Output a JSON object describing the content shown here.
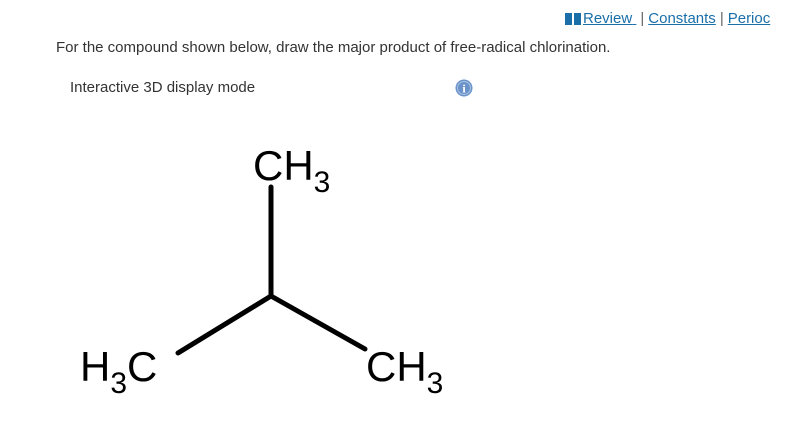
{
  "links": {
    "review": "Review",
    "constants": "Constants",
    "periodic": "Perioc",
    "separator": "|"
  },
  "question": {
    "text": "For the compound shown below, draw the major product of free-radical chlorination."
  },
  "display_mode": {
    "label": "Interactive 3D display mode",
    "info_glyph": "i"
  },
  "molecule": {
    "top_group": {
      "main": "CH",
      "sub": "3"
    },
    "left_group": {
      "pre": "H",
      "sub": "3",
      "post": "C"
    },
    "right_group": {
      "main": "CH",
      "sub": "3"
    }
  },
  "colors": {
    "link": "#1a6fa8",
    "text": "#333333",
    "info_icon": "#6a93c9"
  },
  "icons": {
    "review": "book-icon",
    "info": "info-icon"
  }
}
